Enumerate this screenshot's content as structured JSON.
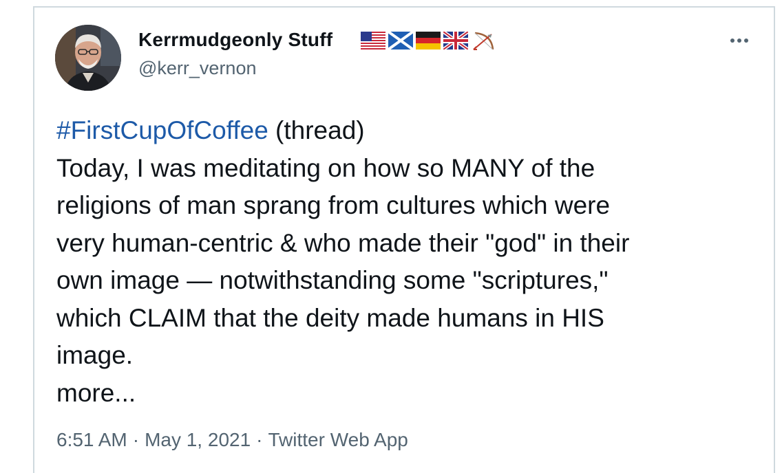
{
  "author": {
    "name": "Kerrmudgeonly Stuff",
    "handle": "@kerr_vernon",
    "name_flags": [
      "us-flag-icon",
      "scotland-flag-icon",
      "germany-flag-icon",
      "uk-flag-icon",
      "bow-and-arrow-icon"
    ]
  },
  "tweet": {
    "hashtag": "#FirstCupOfCoffee",
    "hashtag_suffix": " (thread)",
    "lines": [
      "Today, I was meditating on how so MANY of the",
      "religions of man sprang from cultures which were",
      "very human-centric & who made their \"god\" in their",
      "own image — notwithstanding some \"scriptures,\"",
      "which CLAIM that the deity made humans in HIS",
      "image."
    ],
    "more_label": "more..."
  },
  "meta": {
    "time": "6:51 AM",
    "separator": "·",
    "date": "May 1, 2021",
    "source": "Twitter Web App"
  },
  "colors": {
    "hashtag": "#1d5aa8",
    "text": "#0f1419",
    "secondary": "#536471",
    "border": "#cfd9de"
  }
}
